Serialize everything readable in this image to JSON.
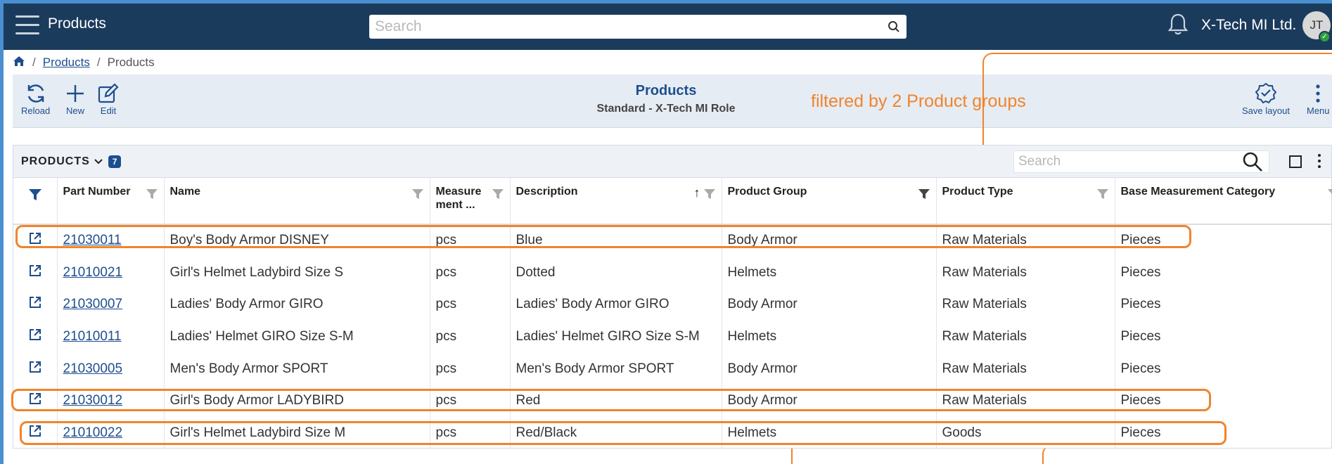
{
  "header": {
    "app_title": "Products",
    "search_placeholder": "Search",
    "company": "X-Tech MI Ltd.",
    "user_initials": "JT"
  },
  "breadcrumb": {
    "items": [
      {
        "label": "Products",
        "link": true
      },
      {
        "label": "Products",
        "link": false
      }
    ]
  },
  "toolbar": {
    "reload": "Reload",
    "new": "New",
    "edit": "Edit",
    "save_layout": "Save layout",
    "menu": "Menu",
    "title": "Products",
    "subtitle": "Standard - X-Tech MI Role"
  },
  "annotation": "filtered by 2 Product groups",
  "grid": {
    "title": "PRODUCTS",
    "count": "7",
    "search_placeholder": "Search",
    "columns": [
      "Part Number",
      "Name",
      "Measure ment ...",
      "Description",
      "Product Group",
      "Product Type",
      "Base Measurement Category"
    ],
    "rows": [
      {
        "part": "21030011",
        "name": "Boy's Body Armor DISNEY",
        "measure": "pcs",
        "desc": "Blue",
        "group": "Body Armor",
        "type": "Raw Materials",
        "base": "Pieces"
      },
      {
        "part": "21010021",
        "name": "Girl's Helmet Ladybird Size S",
        "measure": "pcs",
        "desc": "Dotted",
        "group": "Helmets",
        "type": "Raw Materials",
        "base": "Pieces"
      },
      {
        "part": "21030007",
        "name": "Ladies' Body Armor GIRO",
        "measure": "pcs",
        "desc": "Ladies' Body Armor GIRO",
        "group": "Body Armor",
        "type": "Raw Materials",
        "base": "Pieces"
      },
      {
        "part": "21010011",
        "name": "Ladies' Helmet GIRO Size S-M",
        "measure": "pcs",
        "desc": "Ladies' Helmet GIRO Size S-M",
        "group": "Helmets",
        "type": "Raw Materials",
        "base": "Pieces"
      },
      {
        "part": "21030005",
        "name": "Men's Body Armor SPORT",
        "measure": "pcs",
        "desc": "Men's Body Armor SPORT",
        "group": "Body Armor",
        "type": "Raw Materials",
        "base": "Pieces"
      },
      {
        "part": "21030012",
        "name": "Girl's Body Armor LADYBIRD",
        "measure": "pcs",
        "desc": "Red",
        "group": "Body Armor",
        "type": "Raw Materials",
        "base": "Pieces"
      },
      {
        "part": "21010022",
        "name": "Girl's Helmet Ladybird Size M",
        "measure": "pcs",
        "desc": "Red/Black",
        "group": "Helmets",
        "type": "Goods",
        "base": "Pieces"
      }
    ]
  },
  "colors": {
    "topbar": "#1b3b5c",
    "accent": "#1d4e8f",
    "annotation": "#f0842c"
  }
}
